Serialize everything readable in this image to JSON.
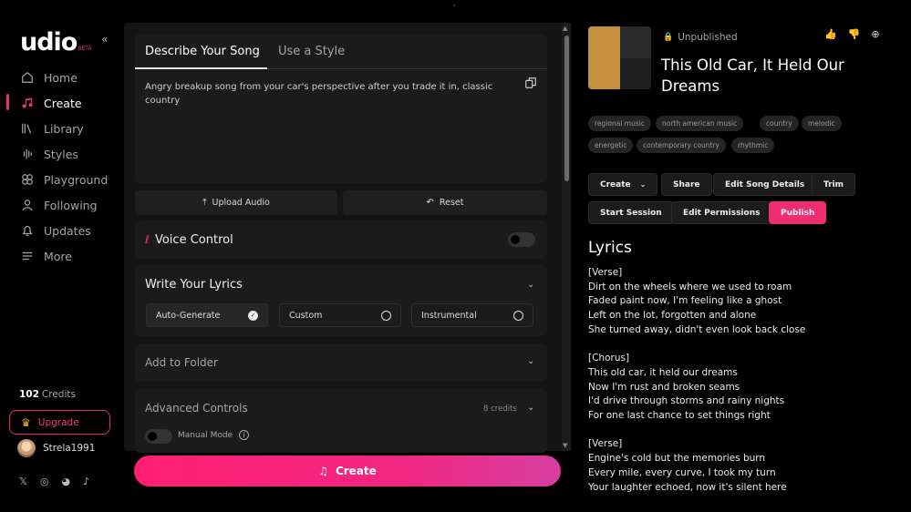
{
  "brand": {
    "name": "udio",
    "badge": "BETA"
  },
  "sidebar": {
    "items": [
      {
        "label": "Home",
        "icon": "home-icon"
      },
      {
        "label": "Create",
        "icon": "music-note-icon"
      },
      {
        "label": "Library",
        "icon": "library-icon"
      },
      {
        "label": "Styles",
        "icon": "waveform-icon"
      },
      {
        "label": "Playground",
        "icon": "gamepad-icon"
      },
      {
        "label": "Following",
        "icon": "user-icon"
      },
      {
        "label": "Updates",
        "icon": "bell-icon"
      },
      {
        "label": "More",
        "icon": "menu-icon"
      }
    ],
    "active_index": 1,
    "credits_count": "102",
    "credits_label": "Credits",
    "upgrade_label": "Upgrade",
    "username": "Strela1991"
  },
  "composer": {
    "tabs": [
      "Describe Your Song",
      "Use a Style"
    ],
    "prompt": "Angry breakup song from your car's perspective after you trade it in, classic country",
    "upload_label": "Upload Audio",
    "reset_label": "Reset",
    "voice_control_label": "Voice Control",
    "lyrics_section_label": "Write Your Lyrics",
    "lyrics_options": [
      "Auto-Generate",
      "Custom",
      "Instrumental"
    ],
    "lyrics_selected": "Auto-Generate",
    "folder_label": "Add to Folder",
    "advanced_label": "Advanced Controls",
    "advanced_credits": "8 credits",
    "manual_mode_label": "Manual Mode",
    "create_label": "Create"
  },
  "song": {
    "status": "Unpublished",
    "title": "This Old Car, It Held Our Dreams",
    "tags": [
      "regional music",
      "north american music",
      "country",
      "melodic",
      "energetic",
      "contemporary country",
      "rhythmic"
    ],
    "actions": {
      "create": "Create",
      "share": "Share",
      "edit_details": "Edit Song Details",
      "trim": "Trim",
      "start_session": "Start Session",
      "edit_permissions": "Edit Permissions",
      "publish": "Publish"
    },
    "lyrics_heading": "Lyrics",
    "lyrics": "[Verse]\nDirt on the wheels where we used to roam\nFaded paint now, I'm feeling like a ghost\nLeft on the lot, forgotten and alone\nShe turned away, didn't even look back close\n\n[Chorus]\nThis old car, it held our dreams\nNow I'm rust and broken seams\nI'd drive through storms and rainy nights\nFor one last chance to set things right\n\n[Verse]\nEngine's cold but the memories burn\nEvery mile, every curve, I took my turn\nYour laughter echoed, now it's silent here"
  },
  "colors": {
    "accent": "#ee2d72",
    "panel": "#141414",
    "card": "#1b1b1b"
  }
}
